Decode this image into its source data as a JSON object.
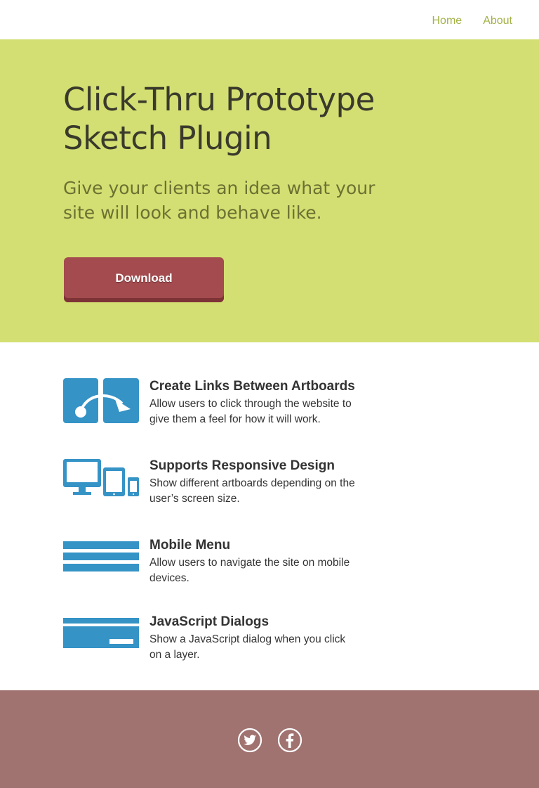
{
  "nav": {
    "home_label": "Home",
    "about_label": "About"
  },
  "hero": {
    "title_line1": "Click-Thru Prototype",
    "title_line2": "Sketch Plugin",
    "subtitle_line1": "Give your clients an idea what your",
    "subtitle_line2": "site will look and behave like.",
    "download_label": "Download"
  },
  "features": [
    {
      "icon": "artboard-links-icon",
      "title": "Create Links Between Artboards",
      "desc_line1": "Allow users to click through the website to",
      "desc_line2": "give them a feel for how it will work."
    },
    {
      "icon": "responsive-devices-icon",
      "title": "Supports Responsive Design",
      "desc_line1": "Show different artboards depending on the",
      "desc_line2": "user’s screen size."
    },
    {
      "icon": "hamburger-menu-icon",
      "title": "Mobile Menu",
      "desc_line1": "Allow users to navigate the site on mobile",
      "desc_line2": "devices."
    },
    {
      "icon": "dialog-box-icon",
      "title": "JavaScript Dialogs",
      "desc_line1": "Show a JavaScript dialog when you click",
      "desc_line2": "on a layer."
    }
  ],
  "footer": {
    "social": [
      "twitter-icon",
      "facebook-icon"
    ]
  },
  "colors": {
    "hero_bg": "#d3df72",
    "nav_link": "#a3b145",
    "button": "#a34b4e",
    "icon_blue": "#3593c6",
    "footer_bg": "#a07371"
  }
}
